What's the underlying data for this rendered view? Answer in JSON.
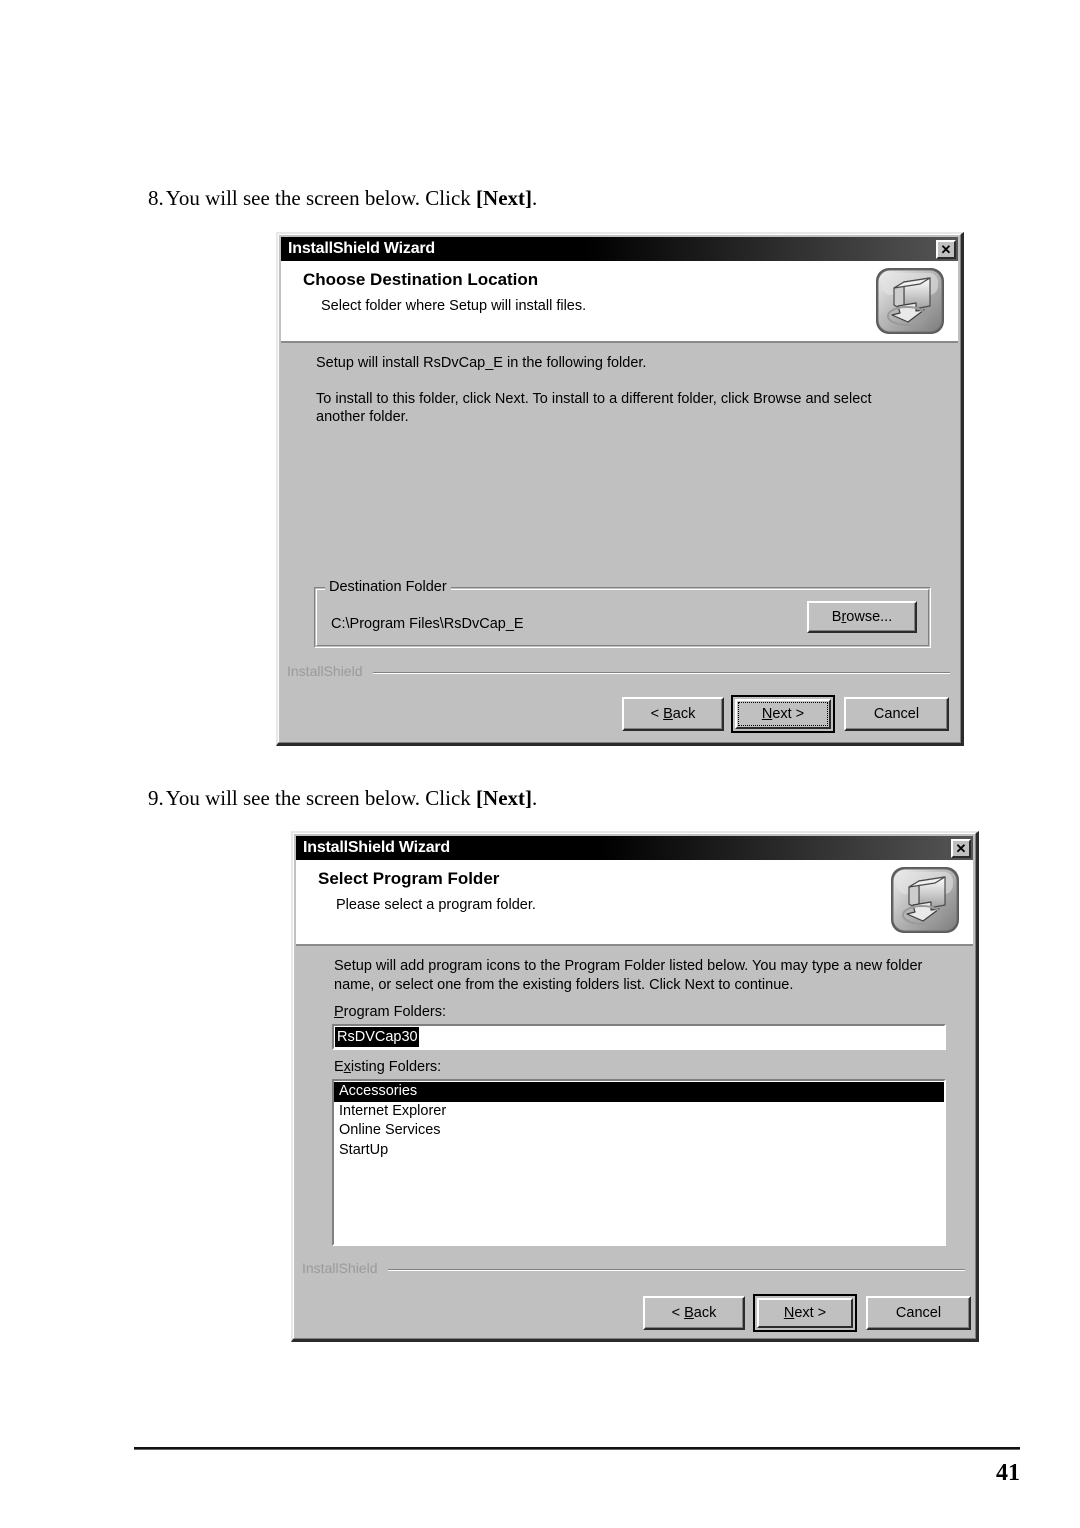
{
  "page": {
    "number": "41"
  },
  "steps": [
    {
      "number": "8.",
      "text": "You will see the screen below. Click ",
      "emphasis": "[Next]",
      "suffix": "."
    },
    {
      "number": "9.",
      "text": "You will see the screen below. Click ",
      "emphasis": "[Next]",
      "suffix": "."
    }
  ],
  "dialog1": {
    "title": "InstallShield Wizard",
    "close_label": "✕",
    "close_icon": "close-icon",
    "header_icon": "installshield-computer-download-icon",
    "header_title": "Choose Destination Location",
    "header_subtitle": "Select folder where Setup will install files.",
    "body_line1": "Setup will install RsDvCap_E in the following folder.",
    "body_line2": "To install to this folder, click Next. To install to a different folder, click Browse and select",
    "body_line3": "another folder.",
    "group": {
      "legend": "Destination Folder",
      "path": "C:\\Program Files\\RsDvCap_E",
      "browse_pre": "B",
      "browse_accel": "r",
      "browse_post": "owse..."
    },
    "footer_brand": "InstallShield",
    "buttons": {
      "back_pre": "< ",
      "back_accel": "B",
      "back_post": "ack",
      "next_accel": "N",
      "next_post": "ext >",
      "cancel": "Cancel"
    }
  },
  "dialog2": {
    "title": "InstallShield Wizard",
    "close_label": "✕",
    "close_icon": "close-icon",
    "header_icon": "installshield-computer-download-icon",
    "header_title": "Select Program Folder",
    "header_subtitle": "Please select a program folder.",
    "body_line1": "Setup will add program icons to the Program Folder listed below.  You may type a new folder",
    "body_line2": "name, or select one from the existing folders list.  Click Next to continue.",
    "program_folders": {
      "label_pre": "P",
      "label_accel": "",
      "label_full": "Program Folders:",
      "value": "RsDVCap30"
    },
    "existing_folders": {
      "label_full": "Existing Folders:",
      "items": [
        {
          "label": "Accessories",
          "selected": true
        },
        {
          "label": "Internet Explorer",
          "selected": false
        },
        {
          "label": "Online Services",
          "selected": false
        },
        {
          "label": "StartUp",
          "selected": false
        }
      ]
    },
    "footer_brand": "InstallShield",
    "buttons": {
      "back_pre": "< ",
      "back_accel": "B",
      "back_post": "ack",
      "next_accel": "N",
      "next_post": "ext >",
      "cancel": "Cancel"
    }
  },
  "colors": {
    "dialog_face": "#c0c0c0",
    "titlebar_start": "#000000",
    "titlebar_end": "#565656",
    "selection": "#000000",
    "brand_text": "#9a9a9a"
  }
}
